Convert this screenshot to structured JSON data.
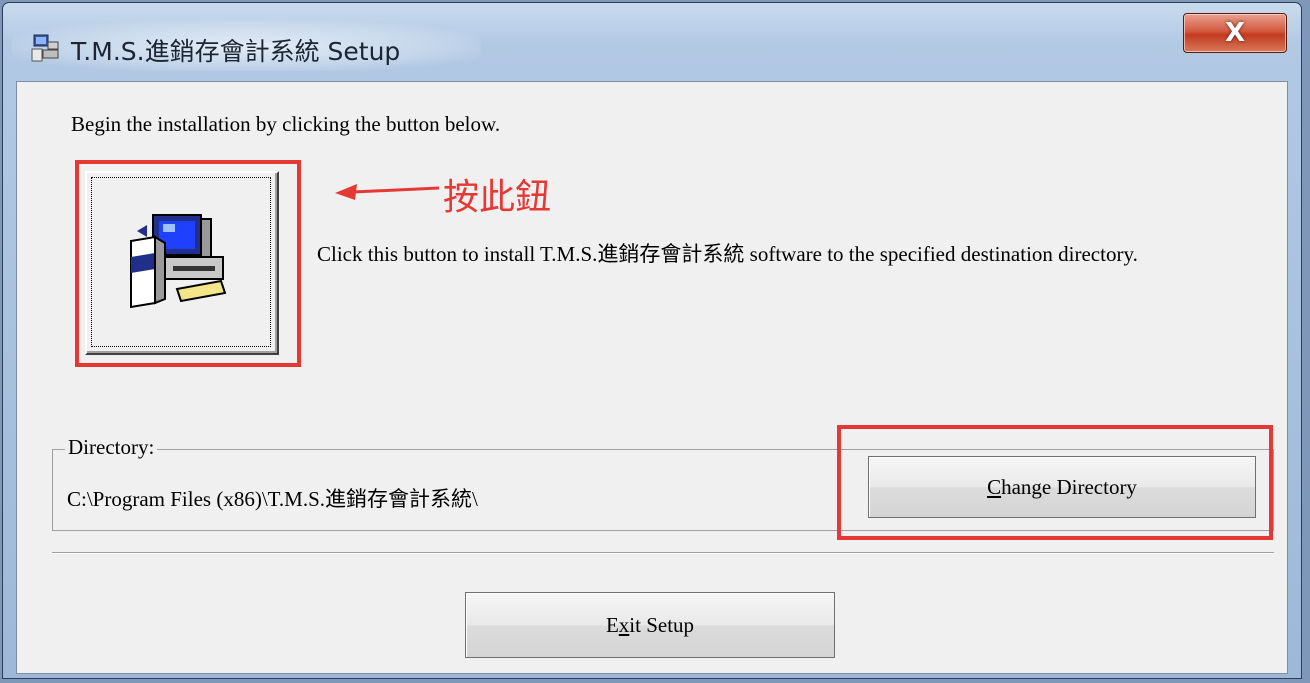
{
  "window": {
    "title": "T.M.S.進銷存會計系統 Setup",
    "close_label": "X"
  },
  "content": {
    "intro_text": "Begin the installation by clicking the button below.",
    "annotation_text": "按此鈕",
    "install_description": "Click this button to install T.M.S.進銷存會計系統 software to the specified destination directory."
  },
  "directory": {
    "group_label": "Directory:",
    "path": "C:\\Program Files (x86)\\T.M.S.進銷存會計系統\\",
    "change_button": {
      "mnemonic": "C",
      "rest": "hange Directory"
    }
  },
  "exit_button": {
    "pre": "E",
    "mnemonic": "x",
    "rest": "it Setup"
  },
  "colors": {
    "annotation_red": "#e53935",
    "dialog_background": "#f0f0f0",
    "title_bar": "#b2c9e4",
    "close_button": "#c23b1f"
  },
  "icons": [
    "setup-app-icon",
    "computer-install-icon",
    "arrow-left-icon",
    "close-icon"
  ]
}
